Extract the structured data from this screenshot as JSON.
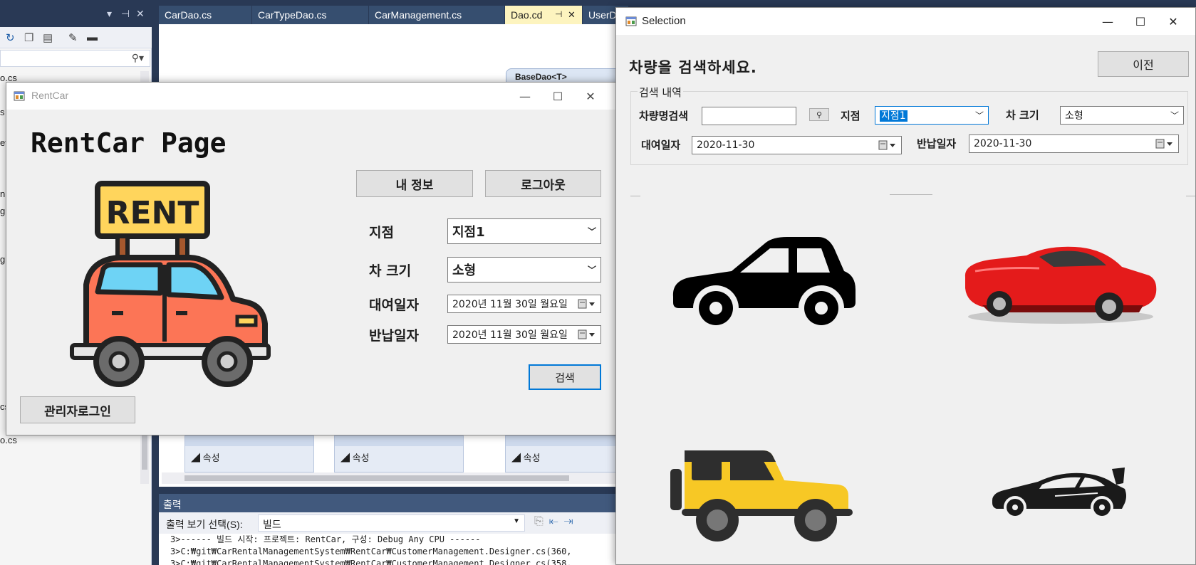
{
  "vs": {
    "left_panel": {
      "tree_fragments": [
        "o.cs",
        "s",
        "et",
        "n",
        "g",
        "g",
        "cs",
        "o.cs"
      ]
    },
    "tabs": [
      {
        "label": "CarDao.cs",
        "active": false
      },
      {
        "label": "CarTypeDao.cs",
        "active": false
      },
      {
        "label": "CarManagement.cs",
        "active": false
      },
      {
        "label": "Dao.cd",
        "active": true
      },
      {
        "label": "UserD",
        "active": false
      }
    ],
    "active_tab_pin": "⊣",
    "active_tab_close": "✕",
    "class_shape_title": "BaseDao<T>",
    "class_panels": [
      {
        "section": "속성"
      },
      {
        "section": "속성"
      },
      {
        "section": "속성"
      }
    ],
    "output": {
      "title": "출력",
      "source_label": "출력 보기 선택(S):",
      "source_value": "빌드",
      "lines": [
        "3>------ 빌드 시작: 프로젝트: RentCar, 구성: Debug Any CPU ------",
        "3>C:₩git₩CarRentalManagementSystem₩RentCar₩CustomerManagement.Designer.cs(360,",
        "3>C:₩git₩CarRentalManagementSystem₩RentCar₩CustomerManagement.Designer.cs(358,"
      ]
    }
  },
  "rentcar": {
    "title": "RentCar",
    "heading": "RentCar Page",
    "sign_text": "RENT",
    "my_info_label": "내 정보",
    "logout_label": "로그아웃",
    "branch_label": "지점",
    "branch_value": "지점1",
    "size_label": "차 크기",
    "size_value": "소형",
    "rent_date_label": "대여일자",
    "rent_date_value": "2020년 11월 30일 월요일",
    "return_date_label": "반납일자",
    "return_date_value": "2020년 11월 30일 월요일",
    "search_label": "검색",
    "admin_login_label": "관리자로그인",
    "colors": {
      "car_body": "#fc7556",
      "car_window": "#6ed3f5",
      "sign": "#ffd55c",
      "pole": "#a6582d"
    }
  },
  "selection": {
    "title": "Selection",
    "prompt": "차량을 검색하세요.",
    "prev_label": "이전",
    "group_label": "검색 내역",
    "car_name_label": "차량명검색",
    "car_name_value": "",
    "search_icon": "magnifier-icon",
    "branch_label": "지점",
    "branch_value": "지점1",
    "size_label": "차 크기",
    "size_value": "소형",
    "rent_date_label": "대여일자",
    "rent_date_value": "2020-11-30",
    "return_date_label": "반납일자",
    "return_date_value": "2020-11-30",
    "cars": [
      {
        "icon": "sedan-icon",
        "color": "#000000"
      },
      {
        "icon": "red-sports-car-image",
        "color": "#e41b1b"
      },
      {
        "icon": "yellow-jeep-icon",
        "color": "#f7c825"
      },
      {
        "icon": "supercar-icon",
        "color": "#1a1a1a"
      }
    ]
  }
}
